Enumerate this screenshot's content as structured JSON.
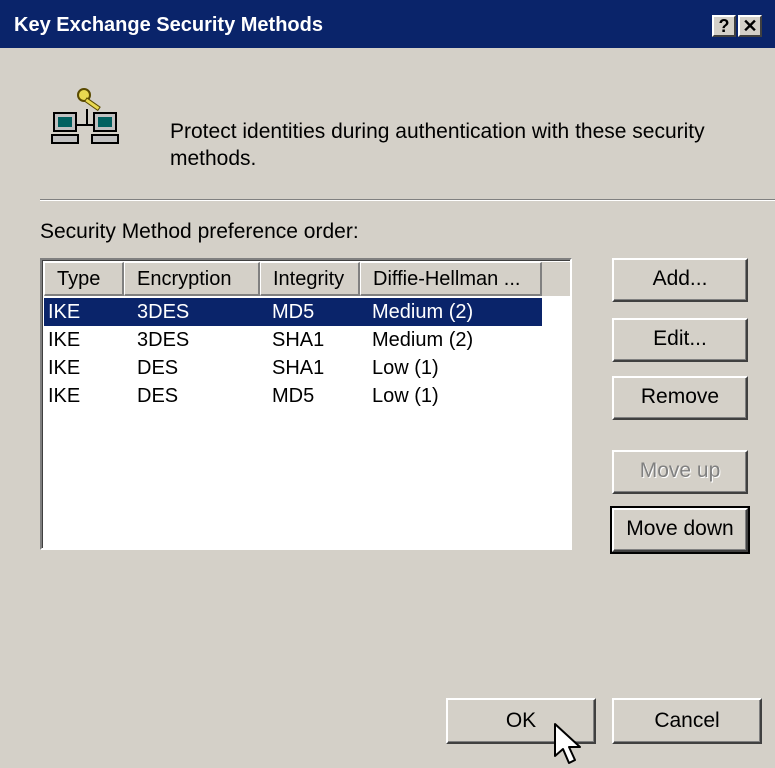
{
  "dialog": {
    "title": "Key Exchange Security Methods",
    "help_button": "?",
    "close_button": "✕",
    "description": "Protect identities during authentication with these security methods.",
    "list_label": "Security Method preference order:"
  },
  "table": {
    "columns": [
      "Type",
      "Encryption",
      "Integrity",
      "Diffie-Hellman ..."
    ],
    "rows": [
      {
        "type": "IKE",
        "encryption": "3DES",
        "integrity": "MD5",
        "dh": "Medium (2)",
        "selected": true
      },
      {
        "type": "IKE",
        "encryption": "3DES",
        "integrity": "SHA1",
        "dh": "Medium (2)",
        "selected": false
      },
      {
        "type": "IKE",
        "encryption": "DES",
        "integrity": "SHA1",
        "dh": "Low (1)",
        "selected": false
      },
      {
        "type": "IKE",
        "encryption": "DES",
        "integrity": "MD5",
        "dh": "Low (1)",
        "selected": false
      }
    ]
  },
  "buttons": {
    "add": "Add...",
    "edit": "Edit...",
    "remove": "Remove",
    "move_up": "Move up",
    "move_down": "Move down",
    "ok": "OK",
    "cancel": "Cancel"
  },
  "icons": {
    "header": "networked-computers-key-icon",
    "cursor": "mouse-pointer-icon"
  },
  "colors": {
    "titlebar": "#0a246a",
    "selection": "#0a246a",
    "face": "#d4d0c8"
  }
}
